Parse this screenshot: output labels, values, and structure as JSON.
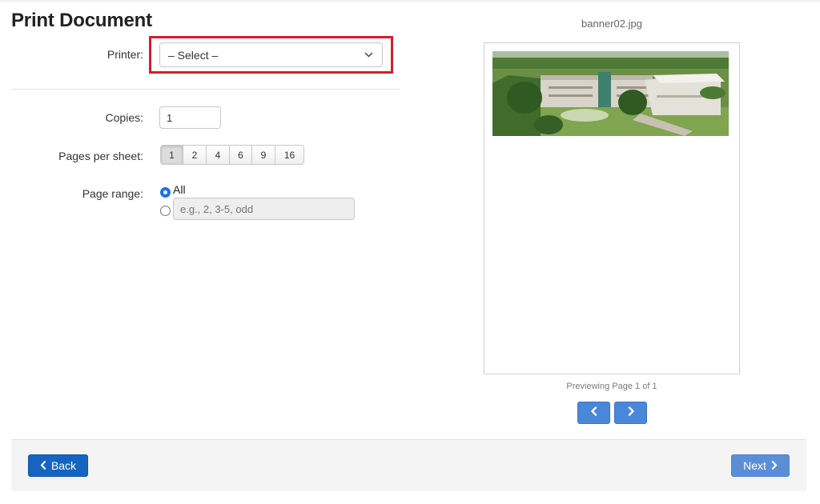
{
  "page": {
    "title": "Print Document"
  },
  "form": {
    "printer_label": "Printer:",
    "printer_value": "– Select –",
    "copies_label": "Copies:",
    "copies_value": "1",
    "pages_per_sheet_label": "Pages per sheet:",
    "pages_per_sheet_options": [
      "1",
      "2",
      "4",
      "6",
      "9",
      "16"
    ],
    "pages_per_sheet_selected": "1",
    "page_range_label": "Page range:",
    "page_range_all_label": "All",
    "page_range_selected": "All",
    "page_range_placeholder": "e.g., 2, 3-5, odd"
  },
  "preview": {
    "file_name": "banner02.jpg",
    "caption": "Previewing Page 1 of 1",
    "prev_icon": "chevron-left-icon",
    "next_icon": "chevron-right-icon"
  },
  "footer": {
    "back_label": "Back",
    "next_label": "Next"
  },
  "colors": {
    "highlight": "#d2202a",
    "primary": "#1565c0",
    "primary_light": "#5a8fd8",
    "radio_checked": "#1a73e8"
  }
}
